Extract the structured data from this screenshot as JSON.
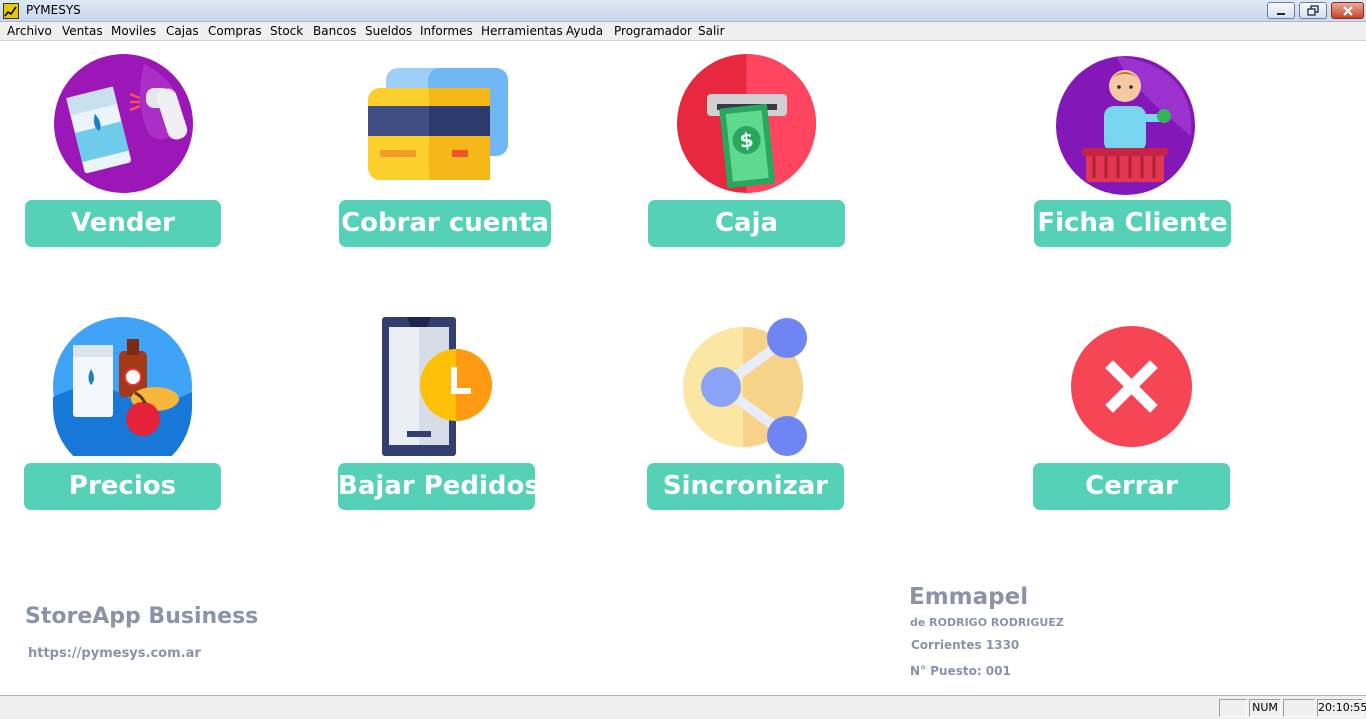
{
  "window": {
    "title": "PYMESYS",
    "app_icon": "chart-icon"
  },
  "menu": [
    "Archivo",
    "Ventas",
    "Moviles",
    "Cajas",
    "Compras",
    "Stock",
    "Bancos",
    "Sueldos",
    "Informes",
    "Herramientas",
    "Ayuda",
    "Programador",
    "Salir"
  ],
  "tiles": {
    "vender": {
      "label": "Vender",
      "icon": "milk-scanner-icon"
    },
    "cobrar": {
      "label": "Cobrar cuenta",
      "icon": "credit-card-icon"
    },
    "caja": {
      "label": "Caja",
      "icon": "atm-cash-icon"
    },
    "ficha": {
      "label": "Ficha Cliente",
      "icon": "customer-basket-icon"
    },
    "precios": {
      "label": "Precios",
      "icon": "grocery-products-icon"
    },
    "bajar": {
      "label": "Bajar Pedidos",
      "icon": "phone-clock-icon"
    },
    "sincronizar": {
      "label": "Sincronizar",
      "icon": "share-nodes-icon"
    },
    "cerrar": {
      "label": "Cerrar",
      "icon": "close-x-icon"
    }
  },
  "brand": {
    "title": "StoreApp Business",
    "url": "https://pymesys.com.ar"
  },
  "company": {
    "name": "Emmapel",
    "owner": "de RODRIGO RODRIGUEZ",
    "address": "Corrientes 1330",
    "post": "N° Puesto: 001"
  },
  "status": {
    "pane1": "",
    "num": "NUM",
    "pane3": "",
    "time": "20:10:55"
  },
  "colors": {
    "button": "#54d1b6",
    "footer_text": "#8b93a8"
  }
}
